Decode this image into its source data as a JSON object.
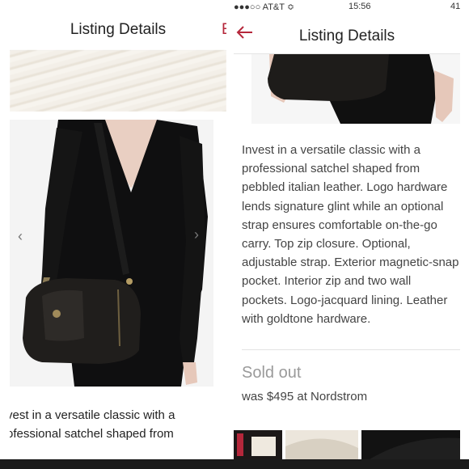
{
  "left": {
    "title": "Listing Details",
    "cut_action": "E",
    "prev_arrow": "‹",
    "next_arrow": "›",
    "description_lines": [
      "vest in a versatile classic with a",
      "ofessional satchel shaped from"
    ]
  },
  "right": {
    "status": {
      "carrier": "●●●○○ AT&T ≎",
      "time": "15:56",
      "battery": "41"
    },
    "back_icon": "arrow-left-icon",
    "title": "Listing Details",
    "description_lines": [
      "Invest in a versatile classic with a",
      "professional satchel shaped from",
      "pebbled italian leather. Logo hardware",
      "lends signature glint while an optional",
      "strap ensures comfortable on-the-go",
      "carry. Top zip closure. Optional,",
      "adjustable strap. Exterior magnetic-snap",
      "pocket. Interior zip and two wall",
      "pockets. Logo-jacquard lining. Leather",
      "with goldtone hardware."
    ],
    "status_label": "Sold out",
    "price_note": "was $495 at Nordstrom"
  },
  "colors": {
    "accent": "#b5273b",
    "text": "#444444",
    "muted": "#9a9a9a"
  }
}
